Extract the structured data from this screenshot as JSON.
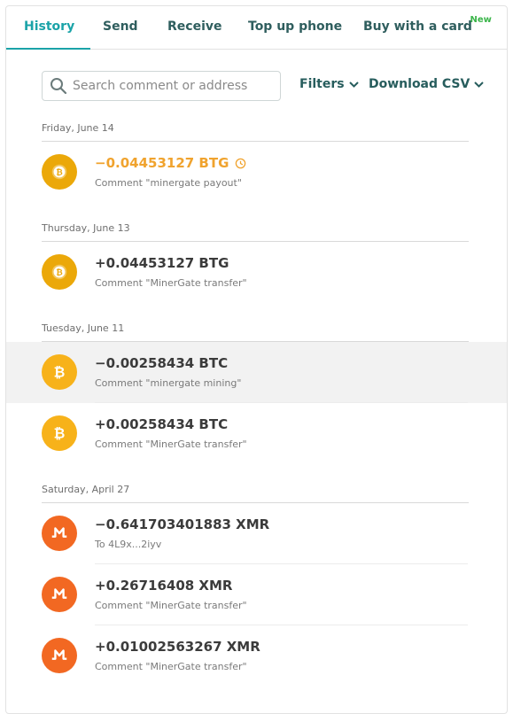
{
  "tabs": [
    {
      "label": "History"
    },
    {
      "label": "Send"
    },
    {
      "label": "Receive"
    },
    {
      "label": "Top up phone"
    },
    {
      "label": "Buy with a card",
      "badge": "New"
    }
  ],
  "search": {
    "placeholder": "Search comment or address"
  },
  "filters_label": "Filters",
  "download_label": "Download CSV",
  "groups": [
    {
      "date": "Friday, June 14",
      "items": [
        {
          "amount": "−0.04453127 BTG",
          "comment": "Comment \"minergate payout\"",
          "coin": "BTG",
          "pending": true
        }
      ]
    },
    {
      "date": "Thursday, June 13",
      "items": [
        {
          "amount": "+0.04453127 BTG",
          "comment": "Comment \"MinerGate transfer\"",
          "coin": "BTG"
        }
      ]
    },
    {
      "date": "Tuesday, June 11",
      "items": [
        {
          "amount": "−0.00258434 BTC",
          "comment": "Comment \"minergate mining\"",
          "coin": "BTC",
          "highlighted": true
        },
        {
          "amount": "+0.00258434 BTC",
          "comment": "Comment \"MinerGate transfer\"",
          "coin": "BTC"
        }
      ]
    },
    {
      "date": "Saturday, April 27",
      "items": [
        {
          "amount": "−0.641703401883 XMR",
          "comment": "To 4L9x...2iyv",
          "coin": "XMR"
        },
        {
          "amount": "+0.26716408 XMR",
          "comment": "Comment \"MinerGate transfer\"",
          "coin": "XMR"
        },
        {
          "amount": "+0.01002563267 XMR",
          "comment": "Comment \"MinerGate transfer\"",
          "coin": "XMR"
        }
      ]
    }
  ],
  "colors": {
    "accent": "#1aa3a8",
    "pending": "#f0a32e",
    "btg": "#eba809",
    "btc": "#f7b21a",
    "xmr": "#f26822",
    "new_badge": "#3bb54a"
  },
  "icons": {
    "BTG": "bitcoin-gold-icon",
    "BTC": "bitcoin-icon",
    "XMR": "monero-icon"
  }
}
